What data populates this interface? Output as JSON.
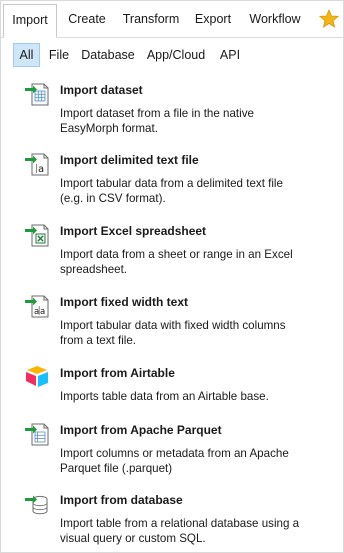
{
  "tabs": [
    {
      "label": "Import",
      "active": true
    },
    {
      "label": "Create",
      "active": false
    },
    {
      "label": "Transform",
      "active": false
    },
    {
      "label": "Export",
      "active": false
    },
    {
      "label": "Workflow",
      "active": false
    }
  ],
  "favorites_icon": "star-icon",
  "filters": [
    {
      "label": "All",
      "active": true
    },
    {
      "label": "File",
      "active": false
    },
    {
      "label": "Database",
      "active": false
    },
    {
      "label": "App/Cloud",
      "active": false
    },
    {
      "label": "API",
      "active": false
    }
  ],
  "items": [
    {
      "icon": "dataset-file-icon",
      "title": "Import dataset",
      "desc": [
        "Import dataset from a file in the native",
        "EasyMorph format."
      ]
    },
    {
      "icon": "delimited-text-file-icon",
      "title": "Import delimited text file",
      "desc": [
        "Import tabular data from a delimited text file",
        "(e.g. in CSV format)."
      ]
    },
    {
      "icon": "excel-file-icon",
      "title": "Import Excel spreadsheet",
      "desc": [
        "Import data from a sheet or range in an Excel",
        "spreadsheet."
      ]
    },
    {
      "icon": "fixed-width-text-icon",
      "title": "Import fixed width text",
      "desc": [
        "Import tabular data with fixed width columns",
        "from a text file."
      ]
    },
    {
      "icon": "airtable-logo-icon",
      "title": "Import from Airtable",
      "desc": [
        "Imports table data from an Airtable base."
      ]
    },
    {
      "icon": "parquet-file-icon",
      "title": "Import from Apache Parquet",
      "desc": [
        "Import columns or metadata from an Apache",
        "Parquet file (.parquet)"
      ]
    },
    {
      "icon": "database-icon",
      "title": "Import from database",
      "desc": [
        "Import table from a relational database using a",
        "visual query or custom SQL."
      ]
    }
  ],
  "colors": {
    "accent_green": "#1f9a3c",
    "excel_green": "#1f7a3c",
    "active_filter_bg": "#cfe6f8",
    "star": "#f3b418"
  }
}
